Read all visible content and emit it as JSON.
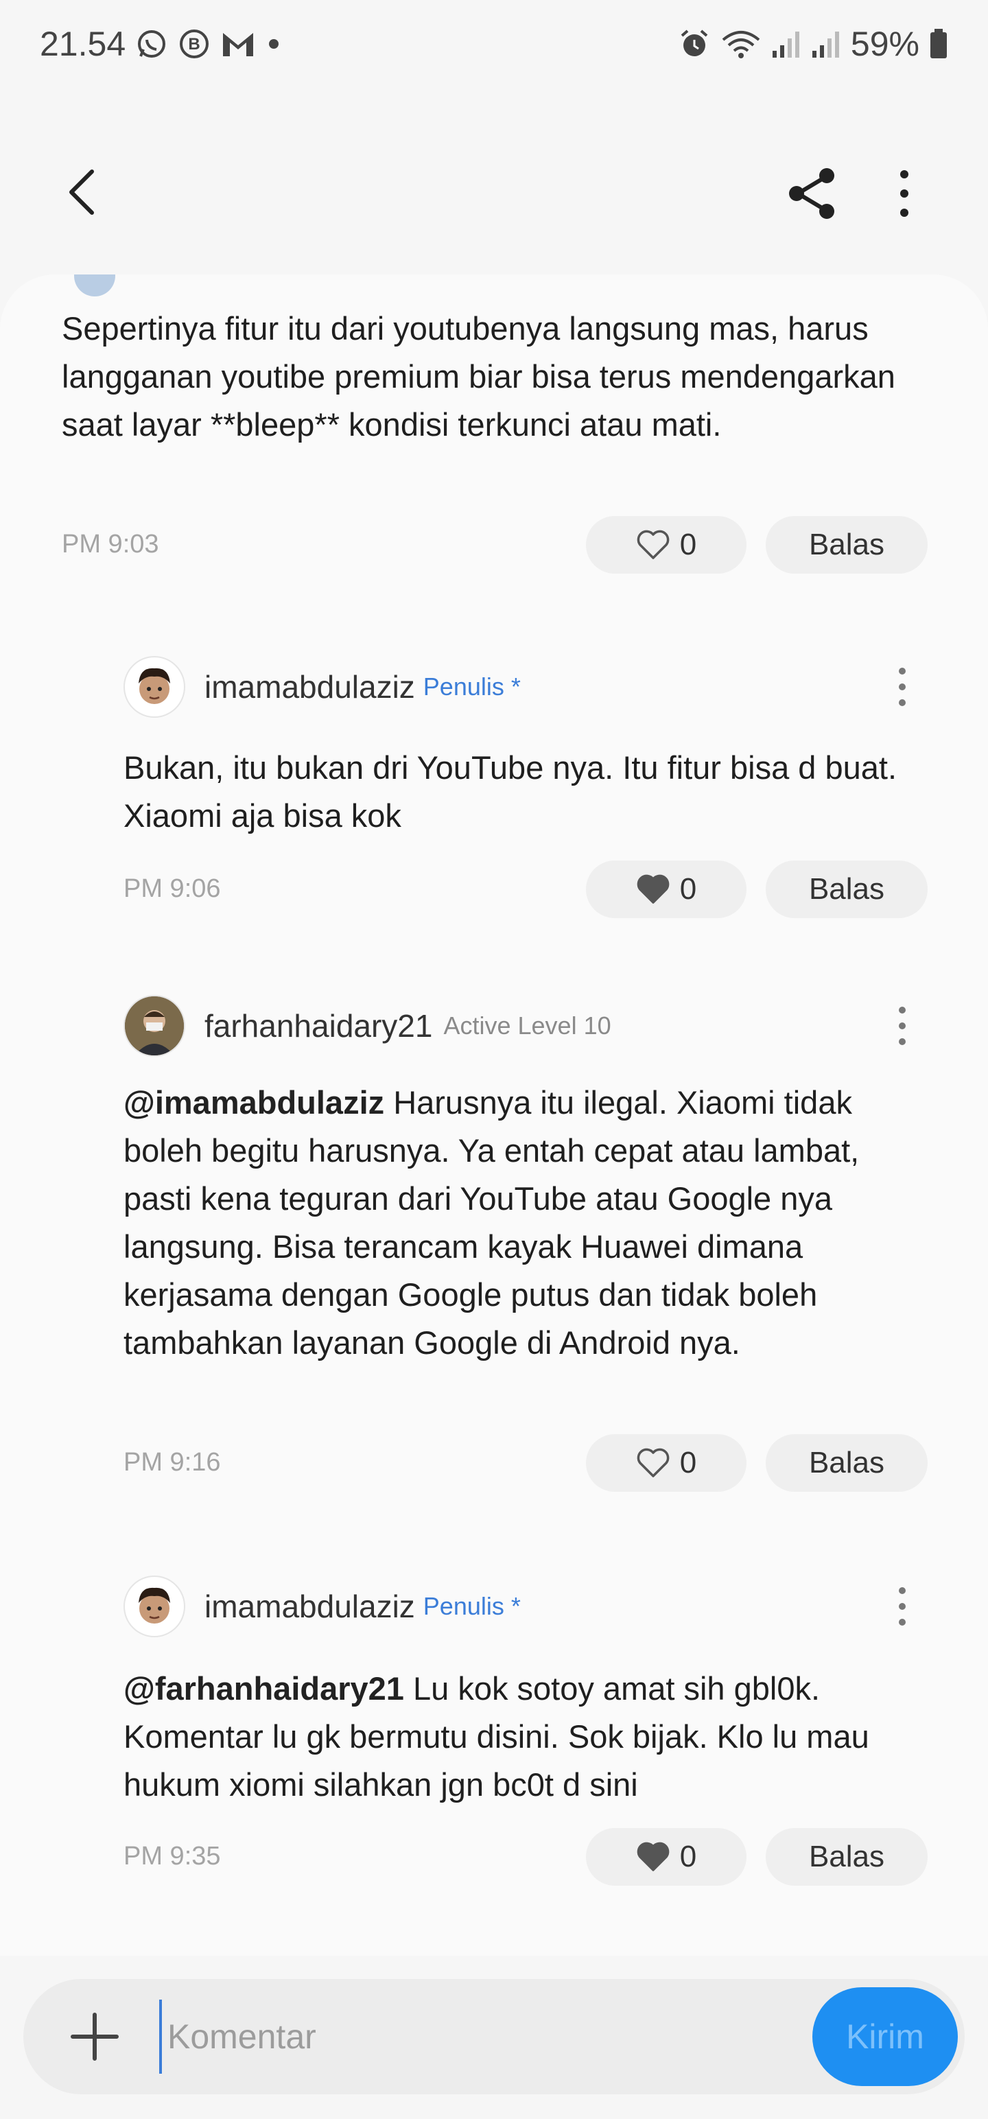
{
  "status_bar": {
    "time": "21.54",
    "battery": "59%",
    "left_icons": [
      "whatsapp-icon",
      "b-app-icon",
      "gmail-icon",
      "dot-icon"
    ],
    "right_icons": [
      "alarm-icon",
      "wifi-icon",
      "signal-icon",
      "signal-icon",
      "battery-icon"
    ]
  },
  "app_bar": {
    "back_icon": "chevron-left-icon",
    "share_icon": "share-icon",
    "more_icon": "more-vertical-icon"
  },
  "comments": [
    {
      "text": "Sepertinya fitur itu dari youtubenya langsung mas, harus langganan youtibe premium biar bisa terus mendengarkan saat layar **bleep** kondisi terkunci atau mati.",
      "time": "PM 9:03",
      "likes": "0",
      "liked": false,
      "reply_label": "Balas"
    },
    {
      "author": "imamabdulaziz",
      "badge": "Penulis *",
      "text": "Bukan, itu bukan dri YouTube nya. Itu fitur bisa d buat. Xiaomi aja bisa kok",
      "time": "PM 9:06",
      "likes": "0",
      "liked": true,
      "reply_label": "Balas"
    },
    {
      "author": "farhanhaidary21",
      "badge": "Active Level 10",
      "mention": "@imamabdulaziz",
      "text": " Harusnya itu ilegal. Xiaomi tidak boleh begitu harusnya. Ya entah cepat atau lambat, pasti kena teguran dari YouTube atau Google nya langsung. Bisa terancam kayak Huawei dimana kerjasama dengan Google putus dan tidak boleh tambahkan layanan Google di Android nya.",
      "time": "PM 9:16",
      "likes": "0",
      "liked": false,
      "reply_label": "Balas"
    },
    {
      "author": "imamabdulaziz",
      "badge": "Penulis *",
      "mention": "@farhanhaidary21",
      "text": " Lu kok sotoy amat sih gbl0k. Komentar lu gk bermutu disini. Sok bijak. Klo lu mau hukum xiomi silahkan jgn bc0t d sini",
      "time": "PM 9:35",
      "likes": "0",
      "liked": true,
      "reply_label": "Balas"
    }
  ],
  "composer": {
    "placeholder": "Komentar",
    "send_label": "Kirim",
    "add_icon": "plus-icon"
  },
  "colors": {
    "accent": "#1e8ff2",
    "writer_badge": "#3b7dd8",
    "pill_bg": "#efefef"
  }
}
